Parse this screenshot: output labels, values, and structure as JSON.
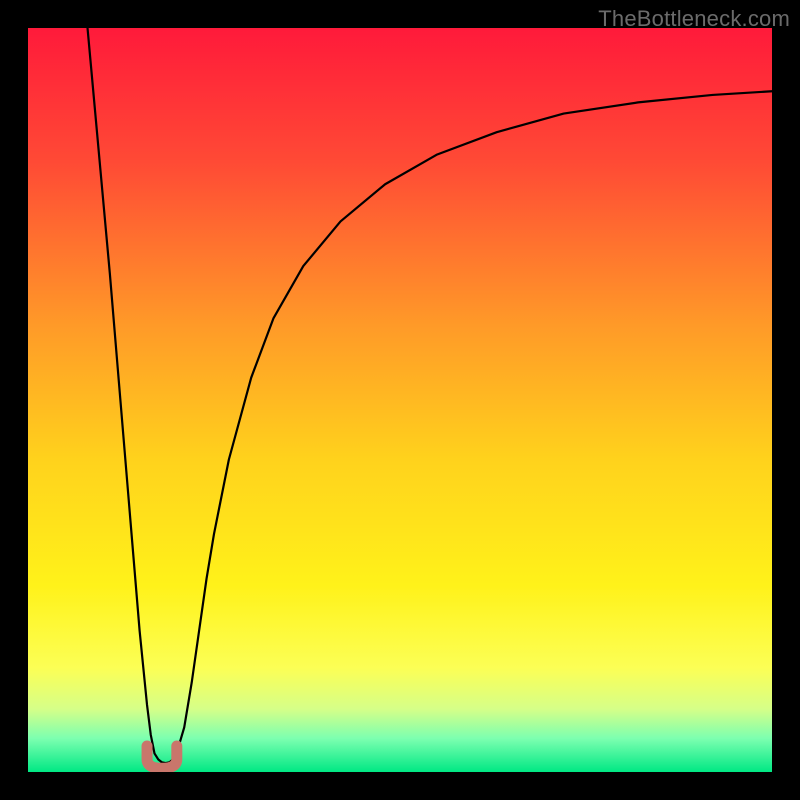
{
  "watermark": "TheBottleneck.com",
  "chart_data": {
    "type": "line",
    "title": "",
    "xlabel": "",
    "ylabel": "",
    "xlim": [
      0,
      100
    ],
    "ylim": [
      0,
      100
    ],
    "grid": false,
    "background_gradient": {
      "type": "vertical",
      "stops": [
        {
          "offset": 0.0,
          "color": "#ff1a3a"
        },
        {
          "offset": 0.18,
          "color": "#ff4a35"
        },
        {
          "offset": 0.4,
          "color": "#ff9a28"
        },
        {
          "offset": 0.58,
          "color": "#ffd21c"
        },
        {
          "offset": 0.75,
          "color": "#fff21a"
        },
        {
          "offset": 0.86,
          "color": "#fcff55"
        },
        {
          "offset": 0.915,
          "color": "#d6ff88"
        },
        {
          "offset": 0.955,
          "color": "#7cffb0"
        },
        {
          "offset": 1.0,
          "color": "#00e884"
        }
      ]
    },
    "series": [
      {
        "name": "curve",
        "stroke": "#000000",
        "x": [
          8,
          9,
          10,
          11,
          12,
          13,
          14,
          15,
          16,
          16.5,
          17,
          17.5,
          18,
          18.5,
          19,
          19.5,
          20,
          21,
          22,
          23,
          24,
          25,
          27,
          30,
          33,
          37,
          42,
          48,
          55,
          63,
          72,
          82,
          92,
          100
        ],
        "y": [
          100,
          89,
          78,
          67,
          55,
          43,
          31,
          19,
          9,
          5,
          2.5,
          1.7,
          1.3,
          1.2,
          1.3,
          1.7,
          2.6,
          6,
          12,
          19,
          26,
          32,
          42,
          53,
          61,
          68,
          74,
          79,
          83,
          86,
          88.5,
          90,
          91,
          91.5
        ]
      }
    ],
    "annotations": [
      {
        "name": "bottleneck-marker",
        "type": "u-shape",
        "x_center": 18,
        "y_center": 2.0,
        "width": 4.0,
        "height": 3.0,
        "color": "#c9766b"
      }
    ]
  }
}
